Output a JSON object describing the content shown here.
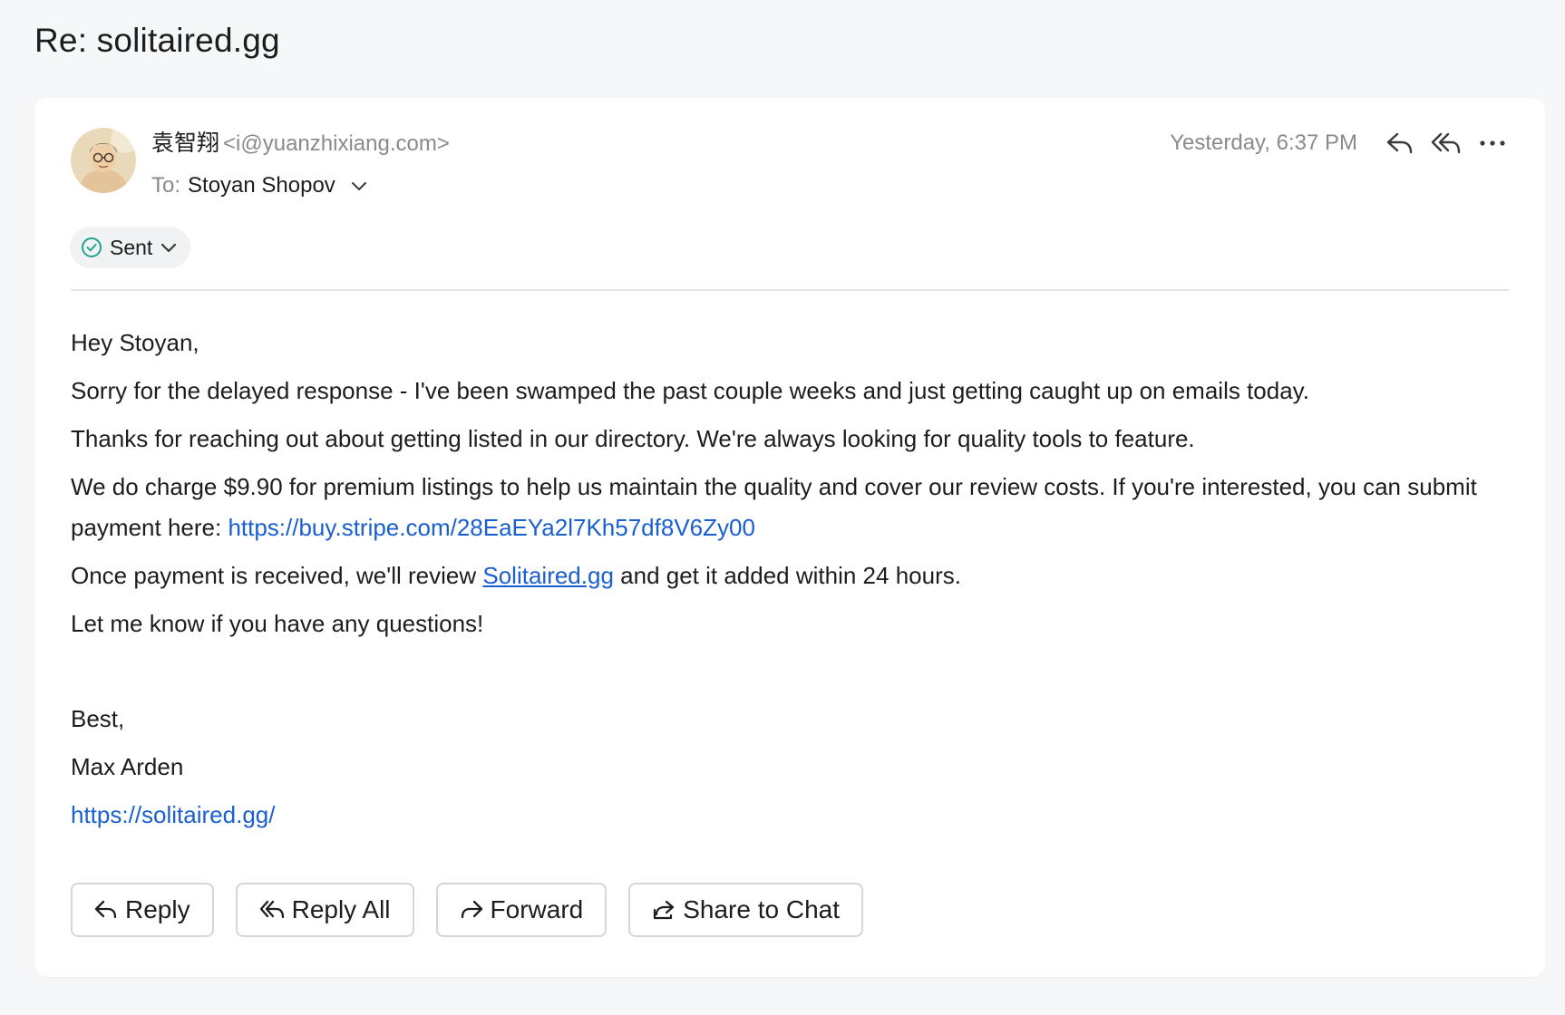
{
  "subject": "Re: solitaired.gg",
  "header": {
    "sender_name": "袁智翔",
    "sender_email": "<i@yuanzhixiang.com>",
    "to_label": "To:",
    "to_name": "Stoyan Shopov",
    "timestamp": "Yesterday, 6:37 PM",
    "status": "Sent"
  },
  "body": {
    "greeting": "Hey Stoyan,",
    "p1": "Sorry for the delayed response - I've been swamped the past couple weeks and just getting caught up on emails today.",
    "p2": "Thanks for reaching out about getting listed in our directory. We're always looking for quality tools to feature.",
    "p3_text": "We do charge $9.90 for premium listings to help us maintain the quality and cover our review costs. If you're interested, you can submit payment here: ",
    "p3_link": "https://buy.stripe.com/28EaEYa2l7Kh57df8V6Zy00",
    "p4_before": "Once payment is received, we'll review ",
    "p4_link": "Solitaired.gg",
    "p4_after": " and get it added within 24 hours.",
    "p5": "Let me know if you have any questions!",
    "sign_off": "Best,",
    "signature_name": "Max Arden",
    "signature_link": "https://solitaired.gg/"
  },
  "actions": {
    "reply": "Reply",
    "reply_all": "Reply All",
    "forward": "Forward",
    "share": "Share to Chat"
  },
  "colors": {
    "link": "#1a5fd0",
    "sent_check": "#1fa38a",
    "background": "#f6f7f9",
    "card": "#ffffff"
  },
  "icons": [
    "reply-icon",
    "reply-all-icon",
    "more-icon",
    "check-circle-icon",
    "chevron-down-icon",
    "forward-icon",
    "share-icon"
  ]
}
